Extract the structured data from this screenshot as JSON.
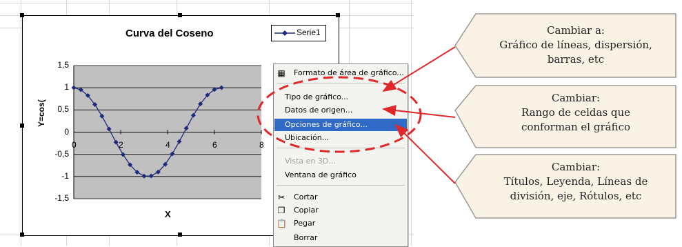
{
  "chart": {
    "title": "Curva del Coseno",
    "legend_label": "Serie1",
    "x_axis_label": "X",
    "y_axis_label": "Y=cos(",
    "y_ticks": [
      "1,5",
      "1",
      "0,5",
      "0",
      "-0,5",
      "-1",
      "-1,5"
    ],
    "x_ticks": [
      "0",
      "2",
      "4",
      "6",
      "8"
    ],
    "plot_bg": "#c0c0c0",
    "series_color": "#1f2a7a"
  },
  "chart_data": {
    "type": "line",
    "title": "Curva del Coseno",
    "xlabel": "X",
    "ylabel": "Y=cos(",
    "xlim": [
      0,
      8
    ],
    "ylim": [
      -1.5,
      1.5
    ],
    "grid": true,
    "legend_position": "top-right",
    "series": [
      {
        "name": "Serie1",
        "x": [
          0,
          0.3,
          0.6,
          0.9,
          1.2,
          1.5,
          1.8,
          2.1,
          2.4,
          2.7,
          3.0,
          3.3,
          3.6,
          3.9,
          4.2,
          4.5,
          4.8,
          5.1,
          5.4,
          5.7,
          6.0,
          6.3
        ],
        "y": [
          1.0,
          0.955,
          0.825,
          0.622,
          0.362,
          0.071,
          -0.227,
          -0.505,
          -0.737,
          -0.904,
          -0.99,
          -0.987,
          -0.897,
          -0.726,
          -0.49,
          -0.211,
          0.087,
          0.378,
          0.635,
          0.835,
          0.96,
          1.0
        ]
      }
    ]
  },
  "context_menu": {
    "items": [
      {
        "label": "Formato de área de gráfico...",
        "icon": "format-icon",
        "state": "normal"
      },
      {
        "label": "Tipo de gráfico...",
        "state": "normal"
      },
      {
        "label": "Datos de origen...",
        "state": "normal"
      },
      {
        "label": "Opciones de gráfico...",
        "state": "highlighted"
      },
      {
        "label": "Ubicación...",
        "state": "normal"
      },
      {
        "label": "Vista en 3D...",
        "state": "disabled"
      },
      {
        "label": "Ventana de gráfico",
        "state": "normal"
      },
      {
        "label": "Cortar",
        "icon": "scissors-icon",
        "state": "normal"
      },
      {
        "label": "Copiar",
        "icon": "copy-icon",
        "state": "normal"
      },
      {
        "label": "Pegar",
        "icon": "paste-icon",
        "state": "normal"
      },
      {
        "label": "Borrar",
        "state": "normal"
      }
    ],
    "highlight_color": "#3169c6"
  },
  "callouts": [
    {
      "lines": [
        "Cambiar a:",
        "Gráfico de líneas, dispersión,",
        "barras, etc"
      ]
    },
    {
      "lines": [
        "Cambiar:",
        "Rango de celdas que",
        "conforman el gráfico"
      ]
    },
    {
      "lines": [
        "Cambiar:",
        "Títulos, Leyenda, Líneas de",
        "división, eje, Rótulos, etc"
      ]
    }
  ],
  "colors": {
    "callout_fill": "#fbf2e6",
    "callout_border": "#999999",
    "arrow": "#e0282a",
    "ellipse": "#e0282a"
  }
}
